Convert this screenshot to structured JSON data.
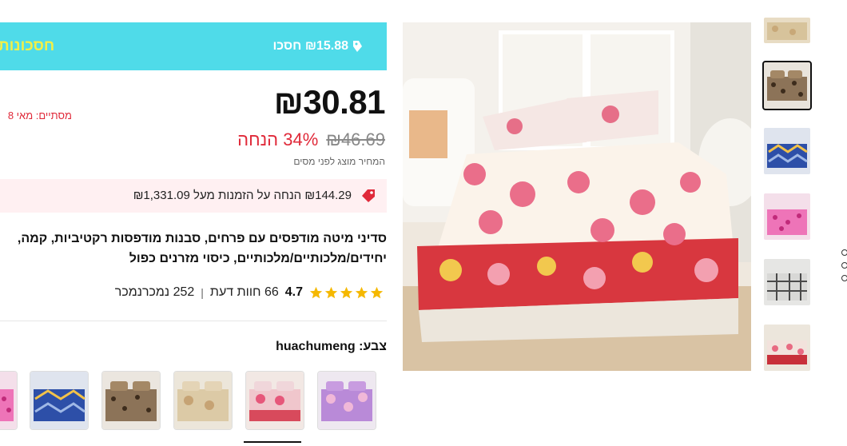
{
  "banner": {
    "save_text": "₪15.88 חסכו",
    "deals_text": "חסכונות",
    "color": "#4fdbe9"
  },
  "price": {
    "current": "₪30.81",
    "original": "₪46.69",
    "discount": "34% הנחה",
    "tax_note": "המחיר מוצג לפני מסים",
    "sale_ends": "מסתיים: מאי 8"
  },
  "coupon": {
    "text": "₪144.29 הנחה על הזמנות מעל ₪1,331.09",
    "icon": "tag-icon"
  },
  "product": {
    "title_line1": "סדיני מיטה מודפסים עם פרחים, סבנות מודפסות רקטיביות, קמה,",
    "title_line2": "יחידים/מלכותיים/מלכותיים, כיסוי מזרנים כפול"
  },
  "rating": {
    "value": "4.7",
    "stars": 5,
    "reviews": "66 חוות דעת",
    "separator": "|",
    "sold": "252 נמכרנמכר"
  },
  "color": {
    "label": "צבע: huachumeng",
    "swatches": [
      "purple-floral",
      "pink-floral",
      "beige-floral",
      "leopard",
      "blue-geometric",
      "pink-dots"
    ]
  },
  "gallery": {
    "thumbnails": [
      "beige-floral",
      "leopard",
      "blue-geometric",
      "pink-dots",
      "grey-plaid",
      "red-floral"
    ],
    "active_index": 1
  },
  "colors": {
    "accent_red": "#e02a3a",
    "star_gold": "#f5b800",
    "coupon_bg": "#fff0f2"
  }
}
